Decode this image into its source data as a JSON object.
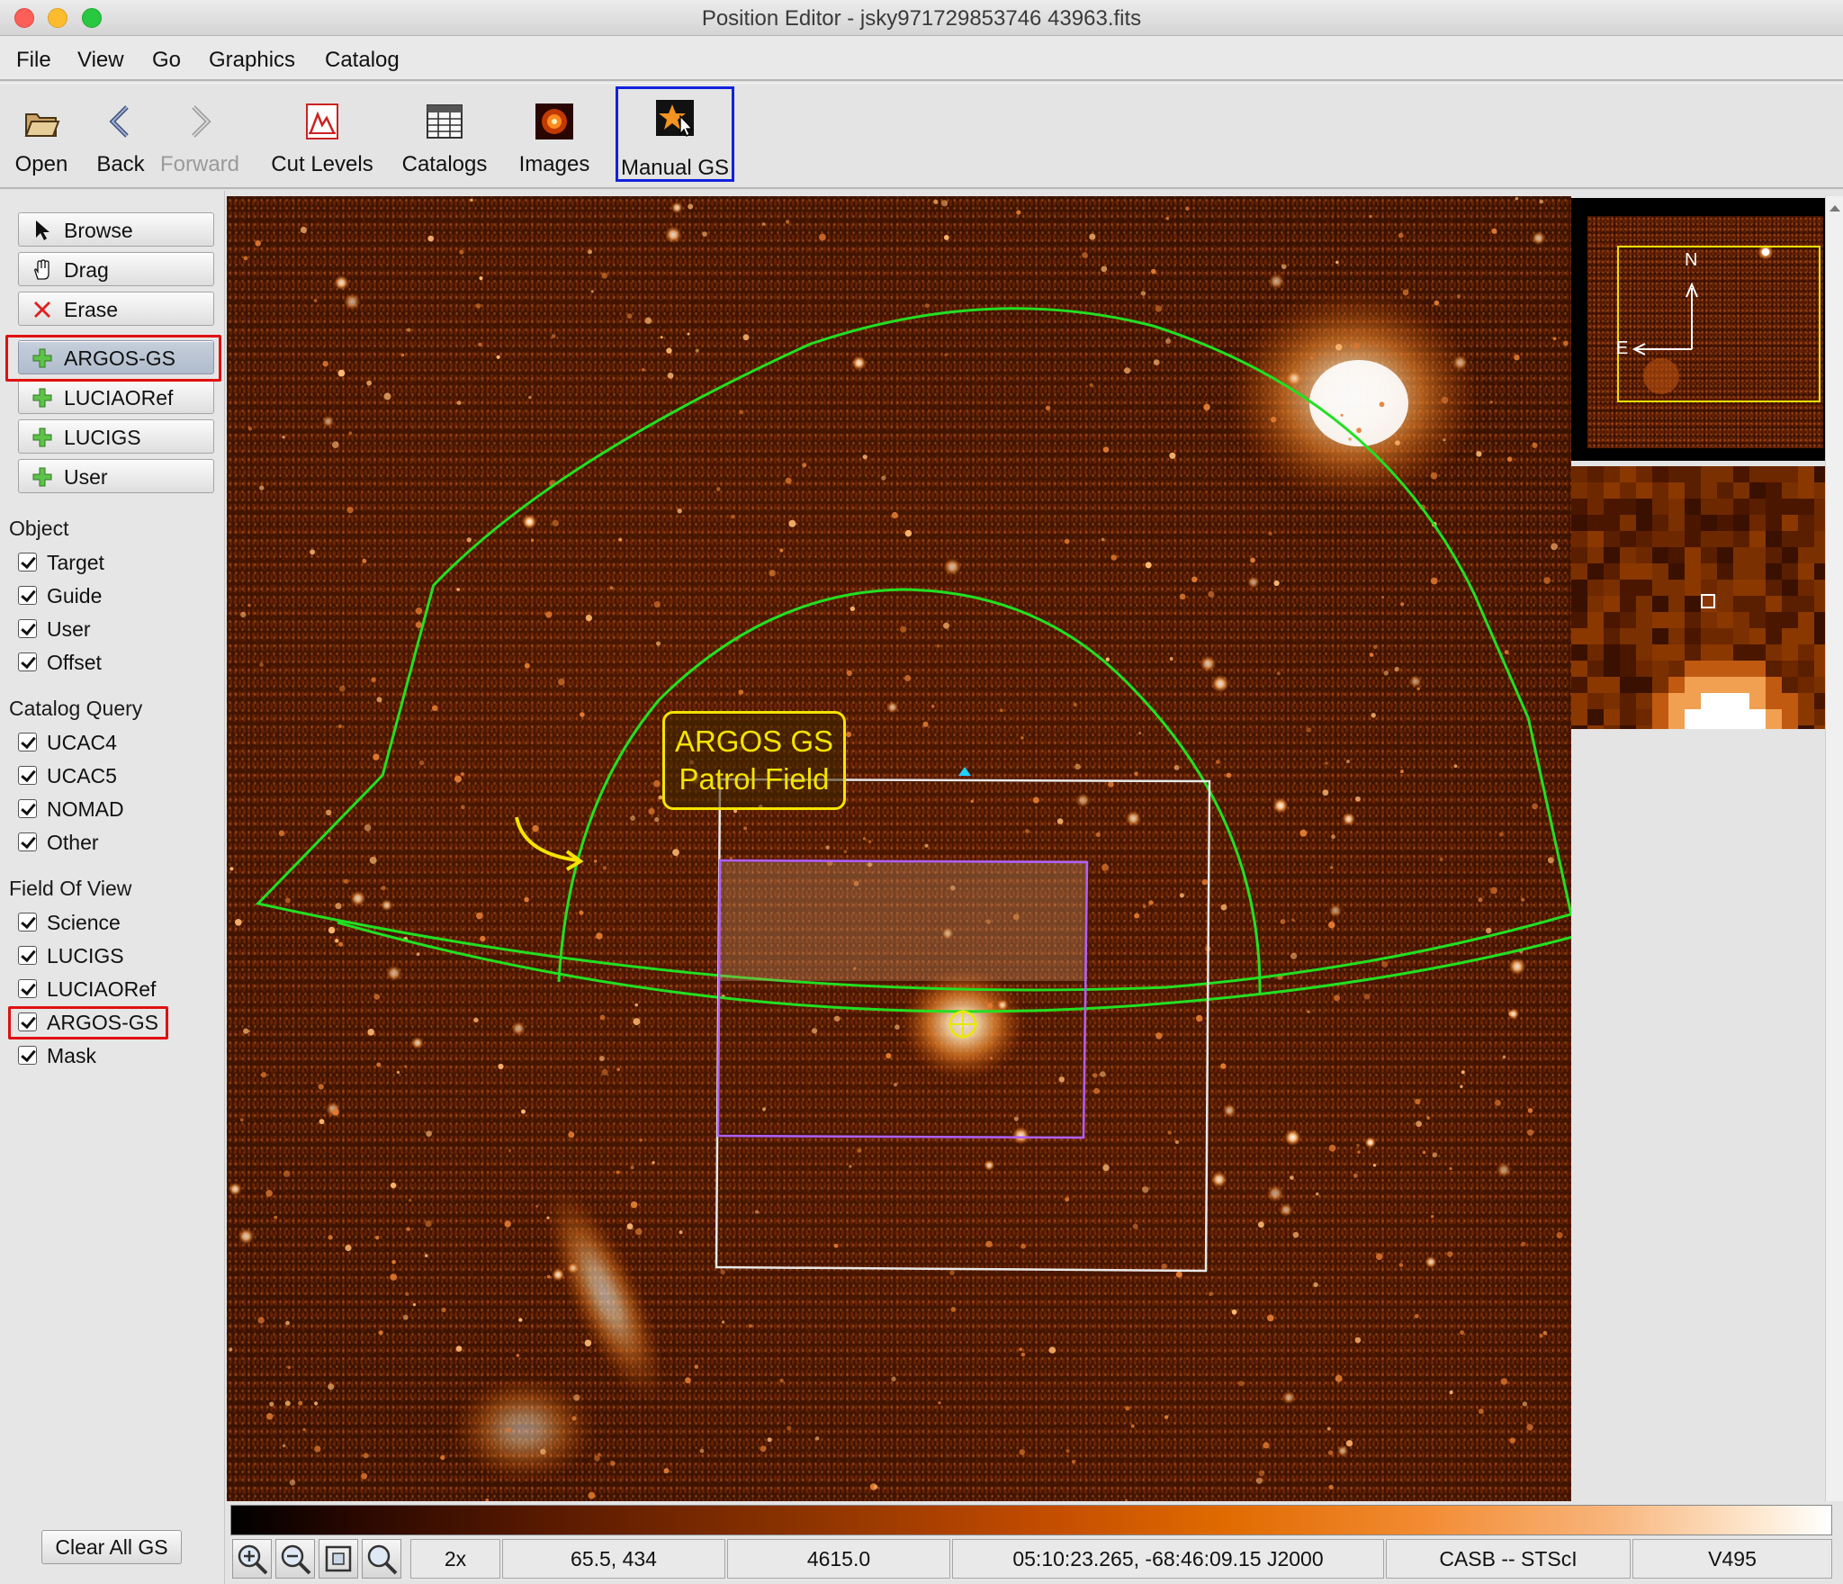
{
  "window": {
    "title": "Position Editor - jsky971729853746 43963.fits"
  },
  "menu": [
    "File",
    "View",
    "Go",
    "Graphics",
    "Catalog"
  ],
  "toolbar": {
    "open": "Open",
    "back": "Back",
    "forward": "Forward",
    "cut_levels": "Cut Levels",
    "catalogs": "Catalogs",
    "images": "Images",
    "manual_gs": "Manual GS"
  },
  "tools": {
    "browse": "Browse",
    "drag": "Drag",
    "erase": "Erase",
    "argos_gs": "ARGOS-GS",
    "luciaoref": "LUCIAORef",
    "lucigs": "LUCIGS",
    "user": "User"
  },
  "sections": {
    "object": {
      "title": "Object",
      "items": [
        "Target",
        "Guide",
        "User",
        "Offset"
      ]
    },
    "catalog_query": {
      "title": "Catalog Query",
      "items": [
        "UCAC4",
        "UCAC5",
        "NOMAD",
        "Other"
      ]
    },
    "field_of_view": {
      "title": "Field Of View",
      "items": [
        "Science",
        "LUCIGS",
        "LUCIAORef",
        "ARGOS-GS",
        "Mask"
      ]
    }
  },
  "clear_all": "Clear All GS",
  "annotation": {
    "line1": "ARGOS GS",
    "line2": "Patrol Field"
  },
  "compass": {
    "north": "N",
    "east": "E"
  },
  "status": {
    "zoom": "2x",
    "pixel": "65.5, 434",
    "value": "4615.0",
    "radec": "05:10:23.265, -68:46:09.15 J2000",
    "source": "CASB -- STScI",
    "band": "V495"
  },
  "colors": {
    "patrol_field": "#22e022",
    "science_fov": "#ffffff",
    "mask": "#b060ff",
    "annotation": "#f4e400",
    "highlight_red": "#e01010",
    "highlight_blue": "#1122dd"
  }
}
